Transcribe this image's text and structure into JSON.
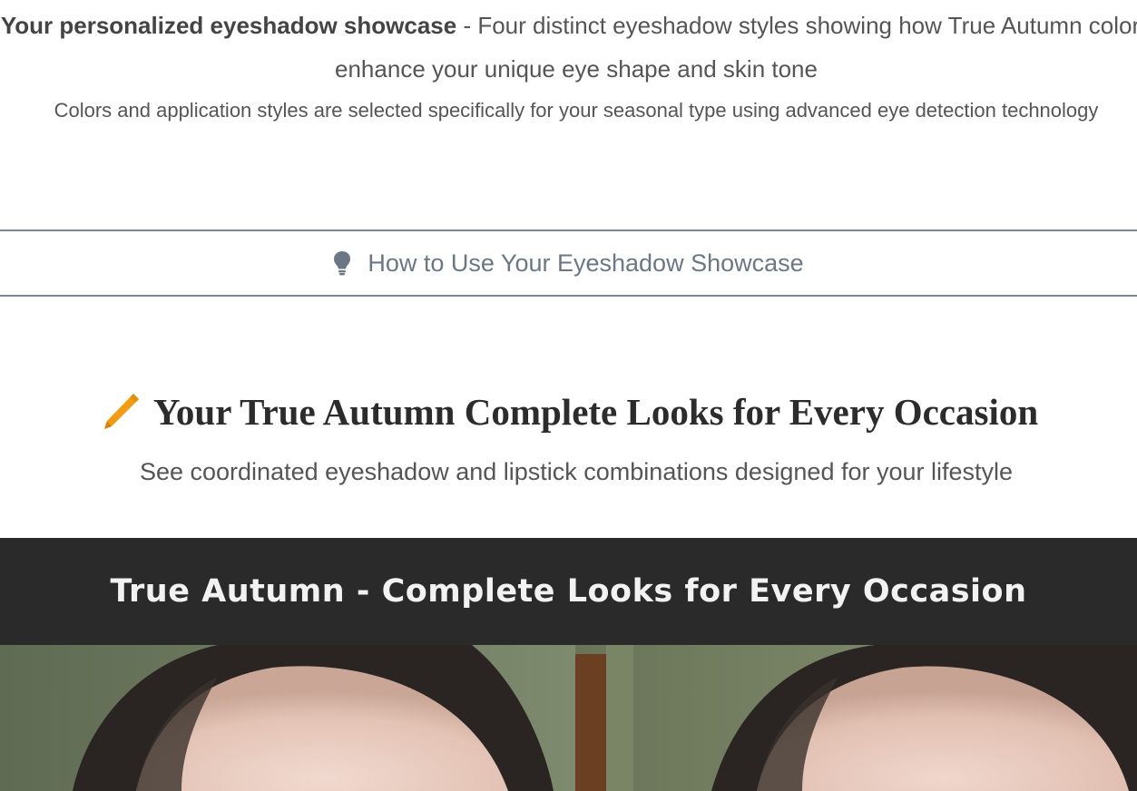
{
  "intro": {
    "highlight": "Your personalized eyeshadow showcase",
    "text": " - Four distinct eyeshadow styles showing how True Autumn colors enhance your unique eye shape and skin tone",
    "note": "Colors and application styles are selected specifically for your seasonal type using advanced eye detection technology"
  },
  "tips": {
    "label": "How to Use Your Eyeshadow Showcase",
    "icon": "lightbulb-icon"
  },
  "looks": {
    "icon": "pencil-icon",
    "title": "Your True Autumn Complete Looks for Every Occasion",
    "subtitle": "See coordinated eyeshadow and lipstick combinations designed for your lifestyle"
  },
  "banner": {
    "title": "True Autumn - Complete Looks for Every Occasion"
  },
  "colors": {
    "accent": "#f39c12",
    "banner_bg": "#2a2a2a",
    "divider": "#7b8794"
  }
}
